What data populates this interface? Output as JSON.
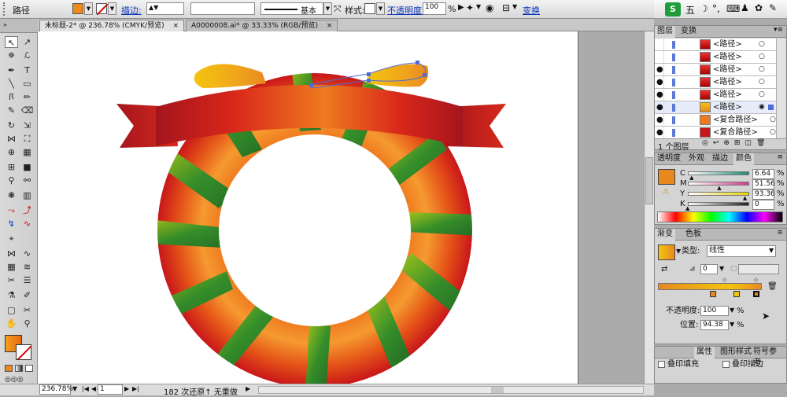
{
  "control": {
    "object_type": "路径",
    "stroke_label": "描边:",
    "stroke_style": "基本",
    "style_label": "样式:",
    "opacity_label": "不透明度:",
    "opacity_value": "100",
    "opacity_unit": "%",
    "transform_link": "变换"
  },
  "system_tray": {
    "ime": "五"
  },
  "doc_tabs": [
    {
      "label": "未标题-2* @ 236.78% (CMYK/预览)",
      "active": true
    },
    {
      "label": "A0000008.ai* @ 33.33% (RGB/预览)",
      "active": false
    }
  ],
  "layers_panel": {
    "tabs": [
      "图层",
      "变换"
    ],
    "rows": [
      "<路径>",
      "<路径>",
      "<路径>",
      "<路径>",
      "<路径>",
      "<路径>",
      "<复合路径>",
      "<复合路径>"
    ],
    "footer": "1 个图层"
  },
  "color_panel": {
    "tabs": [
      "透明度",
      "外观",
      "描边",
      "颜色"
    ],
    "channels": [
      {
        "name": "C",
        "value": "6.64",
        "fraction": 0.066,
        "color": "#1c8a74"
      },
      {
        "name": "M",
        "value": "51.56",
        "fraction": 0.516,
        "color": "#d03a8b"
      },
      {
        "name": "Y",
        "value": "93.36",
        "fraction": 0.934,
        "color": "#e8d300"
      },
      {
        "name": "K",
        "value": "0",
        "fraction": 0.0,
        "color": "#222222"
      }
    ],
    "unit": "%",
    "fill_color": "#e8891f"
  },
  "gradient_panel": {
    "tabs": [
      "渐变",
      "色板"
    ],
    "type_label": "类型:",
    "type_value": "线性",
    "angle_value": "0",
    "opacity_label": "不透明度:",
    "opacity_value": "100",
    "position_label": "位置:",
    "position_value": "94.38",
    "unit": "%"
  },
  "bottom_panel": {
    "tabs": [
      "属性",
      "图形样式",
      "符号参考"
    ],
    "overprint_fill": "叠印填充",
    "overprint_stroke": "叠印描边"
  },
  "status_bar": {
    "zoom": "236.78%",
    "page": "1",
    "info": "182 次还原↑ 无重做"
  },
  "colors": {
    "ring_orange": "#ef7a1f",
    "ring_red": "#c9161a",
    "stripe_green": "#2b8f2a",
    "ribbon_dark": "#a5151d",
    "bow_yellow": "#f3c40f"
  }
}
